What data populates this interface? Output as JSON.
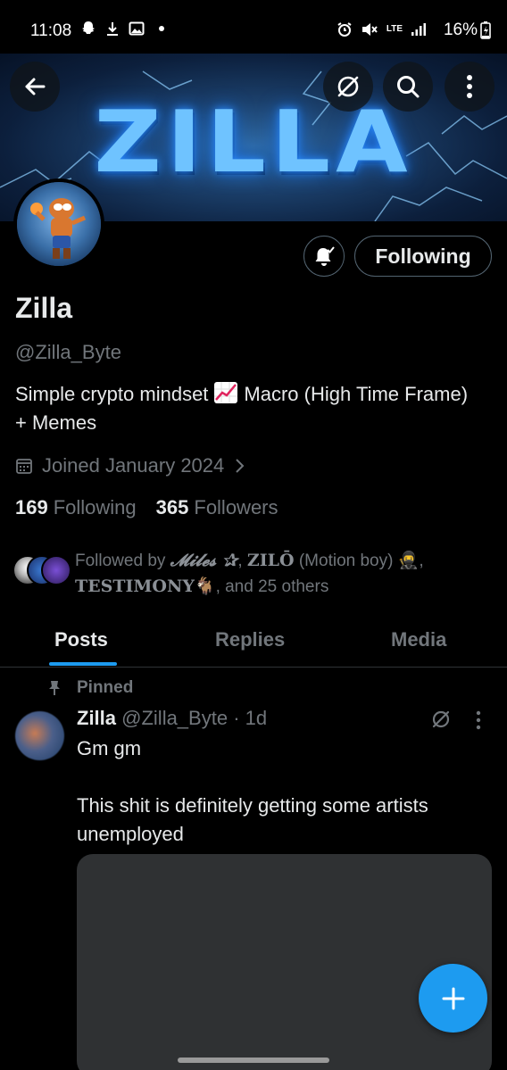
{
  "status_bar": {
    "time": "11:08",
    "network": "LTE",
    "battery": "16%"
  },
  "banner": {
    "title": "ZILLA"
  },
  "profile": {
    "following_button_label": "Following",
    "display_name": "Zilla",
    "handle": "@Zilla_Byte",
    "bio_part1": "Simple crypto mindset",
    "bio_part2": "Macro (High Time Frame) + Memes",
    "joined": "Joined January 2024",
    "following_count": "169",
    "following_label": "Following",
    "followers_count": "365",
    "followers_label": "Followers",
    "followed_by_prefix": "Followed by",
    "followed_by_name1": "𝓜𝓲𝓵𝓮𝓼 ✰",
    "followed_by_name2": "ZILŌ",
    "followed_by_name2_suffix": "(Motion boy) 🥷,",
    "followed_by_name3": "TESTIMONY",
    "followed_by_suffix": ", and 25 others"
  },
  "tabs": [
    {
      "label": "Posts",
      "active": true
    },
    {
      "label": "Replies",
      "active": false
    },
    {
      "label": "Media",
      "active": false
    }
  ],
  "post": {
    "pinned_label": "Pinned",
    "author_name": "Zilla",
    "author_handle": "@Zilla_Byte",
    "timestamp": "· 1d",
    "text": "Gm gm\n\nThis shit is definitely getting some artists unemployed"
  },
  "colors": {
    "accent": "#1d9bf0",
    "background": "#000000",
    "secondary_text": "#71767b"
  },
  "icons": {
    "back": "back-arrow-icon",
    "grok": "grok-icon",
    "search": "search-icon",
    "more": "more-vertical-icon",
    "bell": "notification-bell-icon",
    "calendar": "calendar-icon",
    "pin": "pin-icon",
    "compose": "plus-icon"
  }
}
